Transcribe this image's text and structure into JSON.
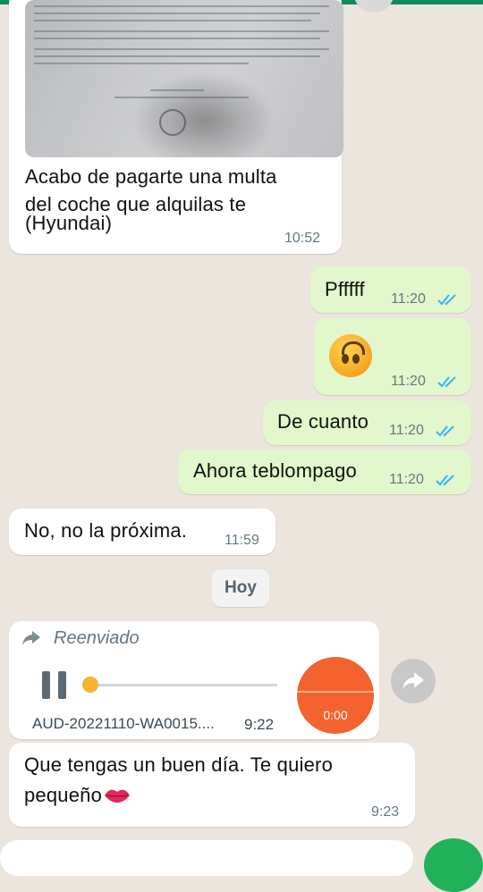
{
  "messages": {
    "image_caption": "Acabo de pagarte una multa del coche que alquilas te (Hyundai)",
    "caption_lines": [
      "Acabo de pagarte una multa",
      "del coche que alquilas te",
      "(Hyundai)"
    ],
    "image_time": "10:52",
    "out1": {
      "text": "Pfffff",
      "time": "11:20"
    },
    "out2": {
      "emoji": "upside-down-face",
      "time": "11:20"
    },
    "out3": {
      "text": "De cuanto",
      "time": "11:20"
    },
    "out4": {
      "text": "Ahora teblompago",
      "time": "11:20"
    },
    "in1": {
      "text": "No, no la próxima.",
      "time": "11:59"
    },
    "date_divider": "Hoy",
    "audio": {
      "forwarded_label": "Reenviado",
      "filename": "AUD-20221110-WA0015....",
      "time": "9:22",
      "duration": "0:00",
      "progress": 0.0
    },
    "last": {
      "line1": "Que tengas un buen día. Te quiero",
      "line2": "pequeño",
      "emoji": "kiss-mark",
      "time": "9:23"
    }
  },
  "colors": {
    "background": "#ece5dd",
    "outgoing": "#e2f7cb",
    "incoming": "#ffffff",
    "read_ticks": "#34b7f1",
    "audio_accent": "#f4622e",
    "send_button": "#21b15a"
  }
}
